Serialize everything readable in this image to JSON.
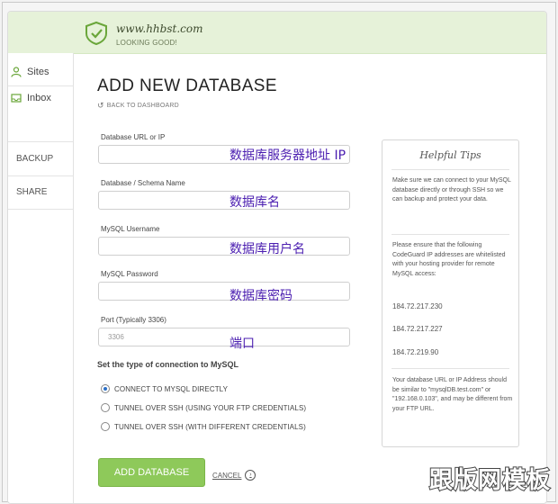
{
  "header": {
    "site_name": "www.hhbst.com",
    "site_status": "LOOKING GOOD!"
  },
  "sidebar": {
    "items": [
      {
        "label": "Sites",
        "icon": "person-icon"
      },
      {
        "label": "Inbox",
        "icon": "inbox-icon"
      }
    ],
    "boxes": [
      {
        "label": "BACKUP"
      },
      {
        "label": "SHARE"
      }
    ]
  },
  "main": {
    "title": "ADD NEW DATABASE",
    "back_link": "BACK TO DASHBOARD",
    "fields": [
      {
        "label": "Database URL or IP",
        "value": "",
        "placeholder": "",
        "annotation": "数据库服务器地址 IP"
      },
      {
        "label": "Database / Schema Name",
        "value": "",
        "placeholder": "",
        "annotation": "数据库名"
      },
      {
        "label": "MySQL Username",
        "value": "",
        "placeholder": "",
        "annotation": "数据库用户名"
      },
      {
        "label": "MySQL Password",
        "value": "",
        "placeholder": "",
        "annotation": "数据库密码"
      },
      {
        "label": "Port (Typically 3306)",
        "value": "3306",
        "placeholder": "3306",
        "annotation": "端口"
      }
    ],
    "connection_title": "Set the type of connection to MySQL",
    "connection_options": [
      {
        "label": "CONNECT TO MYSQL DIRECTLY",
        "selected": true
      },
      {
        "label": "TUNNEL OVER SSH (USING YOUR FTP CREDENTIALS)",
        "selected": false
      },
      {
        "label": "TUNNEL OVER SSH (WITH DIFFERENT CREDENTIALS)",
        "selected": false
      }
    ],
    "submit_label": "ADD DATABASE",
    "cancel_label": "CANCEL"
  },
  "tips": {
    "title": "Helpful Tips",
    "paragraph1": "Make sure we can connect to your MySQL database directly or through SSH so we can backup and protect your data.",
    "paragraph2": "Please ensure that the following CodeGuard IP addresses are whitelisted with your hosting provider for remote MySQL access:",
    "ips": [
      "184.72.217.230",
      "184.72.217.227",
      "184.72.219.90"
    ],
    "paragraph3": "Your database URL or IP Address should be similar to \"mysqlDB.test.com\" or \"192.168.0.103\", and may be different from your FTP URL."
  },
  "watermark": "跟版网模板",
  "colors": {
    "accent_green": "#8ec95a",
    "header_bg": "#e6f2d9",
    "annotation": "#4a1db0",
    "radio_selected": "#2b6fc7"
  }
}
